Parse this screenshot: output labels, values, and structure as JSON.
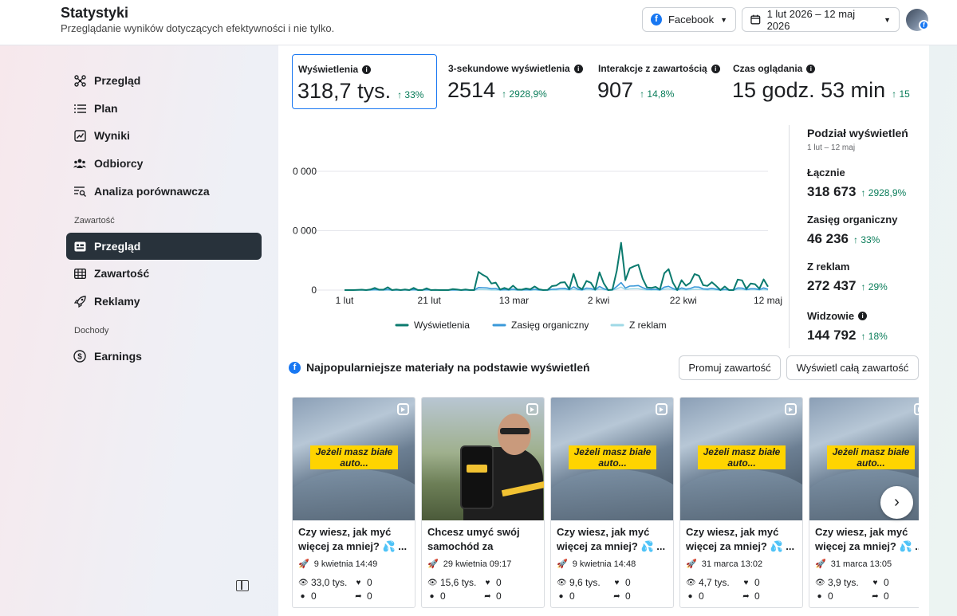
{
  "header": {
    "title": "Statystyki",
    "subtitle": "Przeglądanie wyników dotyczących efektywności i nie tylko.",
    "platform": "Facebook",
    "date_range": "1 lut 2026 – 12 maj 2026"
  },
  "sidebar": {
    "items_top": [
      {
        "label": "Przegląd",
        "icon": "nodes-icon"
      },
      {
        "label": "Plan",
        "icon": "list-icon"
      },
      {
        "label": "Wyniki",
        "icon": "line-chart-icon"
      },
      {
        "label": "Odbiorcy",
        "icon": "people-icon"
      },
      {
        "label": "Analiza porównawcza",
        "icon": "compare-icon"
      }
    ],
    "section_content": "Zawartość",
    "items_content": [
      {
        "label": "Przegląd",
        "icon": "overview-card-icon",
        "active": true
      },
      {
        "label": "Zawartość",
        "icon": "table-icon"
      },
      {
        "label": "Reklamy",
        "icon": "rocket-icon"
      }
    ],
    "section_income": "Dochody",
    "items_income": [
      {
        "label": "Earnings",
        "icon": "dollar-icon"
      }
    ]
  },
  "metrics": [
    {
      "label": "Wyświetlenia",
      "value": "318,7 tys.",
      "change": "↑ 33%",
      "selected": true
    },
    {
      "label": "3-sekundowe wyświetlenia",
      "value": "2514",
      "change": "↑ 2928,9%"
    },
    {
      "label": "Interakcje z zawartością",
      "value": "907",
      "change": "↑ 14,8%"
    },
    {
      "label": "Czas oglądania",
      "value": "15 godz. 53 min",
      "change": "↑ 15"
    }
  ],
  "chart_data": {
    "type": "line",
    "x_tick_labels": [
      "1 lut",
      "21 lut",
      "13 mar",
      "2 kwi",
      "22 kwi",
      "12 maj"
    ],
    "y_tick_labels": [
      "0",
      "0 000",
      "0 000"
    ],
    "ylim": [
      0,
      60000
    ],
    "series": [
      {
        "name": "Wyświetlenia",
        "color": "#0b7a6e",
        "values": [
          0,
          0,
          0,
          100,
          200,
          0,
          300,
          1100,
          200,
          200,
          1400,
          0,
          300,
          0,
          300,
          0,
          1100,
          0,
          0,
          900,
          0,
          100,
          0,
          0,
          0,
          500,
          300,
          0,
          300,
          0,
          0,
          9200,
          7700,
          6500,
          3300,
          3800,
          300,
          1100,
          300,
          2200,
          300,
          200,
          800,
          400,
          1800,
          400,
          0,
          100,
          2000,
          2300,
          3800,
          4000,
          500,
          8200,
          1700,
          400,
          4600,
          3700,
          200,
          9000,
          3400,
          0,
          200,
          9800,
          23900,
          5000,
          11000,
          12000,
          12800,
          5700,
          1300,
          1100,
          1600,
          300,
          8500,
          10600,
          3700,
          0,
          5000,
          2200,
          3700,
          8100,
          7300,
          2500,
          2100,
          4000,
          2100,
          0,
          1800,
          0,
          0,
          5300,
          4900,
          600,
          3300,
          3000,
          700,
          5400,
          1700
        ]
      },
      {
        "name": "Zasięg organiczny",
        "color": "#3a99d9",
        "values": [
          0,
          0,
          0,
          100,
          100,
          0,
          100,
          300,
          100,
          100,
          300,
          0,
          100,
          0,
          100,
          0,
          300,
          0,
          0,
          200,
          0,
          0,
          0,
          0,
          0,
          100,
          100,
          0,
          100,
          0,
          0,
          1300,
          1200,
          1100,
          700,
          800,
          100,
          300,
          100,
          500,
          100,
          100,
          200,
          100,
          400,
          100,
          0,
          0,
          400,
          500,
          800,
          900,
          200,
          1600,
          500,
          100,
          1000,
          800,
          100,
          1800,
          700,
          0,
          100,
          1800,
          3800,
          1000,
          2000,
          2100,
          2300,
          1200,
          400,
          300,
          400,
          100,
          1500,
          1900,
          800,
          0,
          1100,
          500,
          800,
          1600,
          1500,
          600,
          500,
          900,
          500,
          0,
          400,
          0,
          0,
          1100,
          1000,
          200,
          700,
          700,
          200,
          1100,
          400
        ]
      },
      {
        "name": "Z reklam",
        "color": "#9fd9e6",
        "values": [
          0,
          0,
          0,
          0,
          0,
          0,
          0,
          100,
          0,
          0,
          100,
          0,
          0,
          0,
          0,
          0,
          100,
          0,
          0,
          100,
          0,
          0,
          0,
          0,
          0,
          0,
          0,
          0,
          0,
          0,
          0,
          300,
          300,
          200,
          100,
          100,
          0,
          100,
          0,
          100,
          0,
          0,
          100,
          0,
          100,
          0,
          0,
          0,
          100,
          100,
          200,
          200,
          100,
          400,
          100,
          0,
          300,
          200,
          0,
          500,
          200,
          0,
          0,
          600,
          1500,
          300,
          600,
          700,
          700,
          300,
          100,
          100,
          100,
          0,
          500,
          600,
          200,
          0,
          300,
          100,
          200,
          400,
          400,
          200,
          100,
          200,
          100,
          0,
          100,
          0,
          0,
          300,
          300,
          100,
          200,
          200,
          100,
          300,
          100
        ]
      }
    ],
    "legend": [
      "Wyświetlenia",
      "Zasięg organiczny",
      "Z reklam"
    ],
    "legend_position": "bottom"
  },
  "breakdown": {
    "title": "Podział wyświetleń",
    "period": "1 lut – 12 maj",
    "items": [
      {
        "label": "Łącznie",
        "value": "318 673",
        "change": "↑ 2928,9%"
      },
      {
        "label": "Zasięg organiczny",
        "value": "46 236",
        "change": "↑ 33%"
      },
      {
        "label": "Z reklam",
        "value": "272 437",
        "change": "↑ 29%"
      },
      {
        "label": "Widzowie",
        "value": "144 792",
        "change": "↑ 18%",
        "info": true
      }
    ]
  },
  "top_content": {
    "title": "Najpopularniejsze materiały na podstawie wyświetleń",
    "promote_button": "Promuj zawartość",
    "view_all_button": "Wyświetl całą zawartość",
    "cards": [
      {
        "title": "Czy wiesz, jak myć więcej za mniej? 💦 ...",
        "caption": "Jeżeli masz białe auto...",
        "date": "9 kwietnia 14:49",
        "views": "33,0 tys.",
        "likes": "0",
        "comments": "0",
        "shares": "0",
        "thumb": "car"
      },
      {
        "title": "Chcesz umyć swój samochód za darmo?...",
        "caption": "",
        "date": "29 kwietnia 09:17",
        "views": "15,6 tys.",
        "likes": "0",
        "comments": "0",
        "shares": "0",
        "thumb": "person"
      },
      {
        "title": "Czy wiesz, jak myć więcej za mniej? 💦 ...",
        "caption": "Jeżeli masz białe auto...",
        "date": "9 kwietnia 14:48",
        "views": "9,6 tys.",
        "likes": "0",
        "comments": "0",
        "shares": "0",
        "thumb": "car"
      },
      {
        "title": "Czy wiesz, jak myć więcej za mniej? 💦 ...",
        "caption": "Jeżeli masz białe auto...",
        "date": "31 marca 13:02",
        "views": "4,7 tys.",
        "likes": "0",
        "comments": "0",
        "shares": "0",
        "thumb": "car"
      },
      {
        "title": "Czy wiesz, jak myć więcej za mniej? 💦 ...",
        "caption": "Jeżeli masz białe auto...",
        "date": "31 marca 13:05",
        "views": "3,9 tys.",
        "likes": "0",
        "comments": "0",
        "shares": "0",
        "thumb": "car"
      }
    ]
  }
}
